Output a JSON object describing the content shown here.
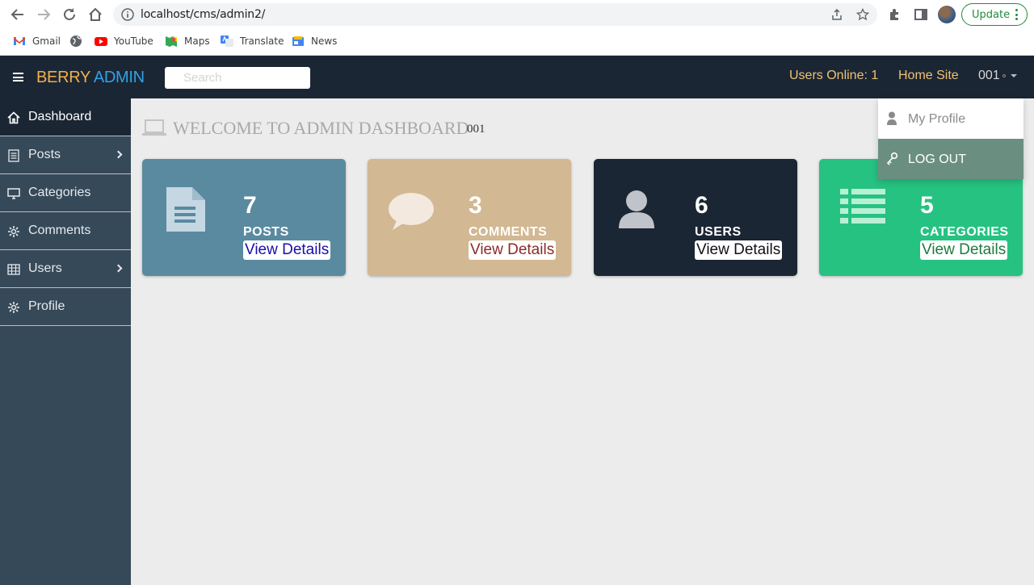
{
  "browser": {
    "url": "localhost/cms/admin2/",
    "update_label": "Update",
    "bookmarks": [
      {
        "label": "Gmail",
        "icon": "gmail-icon"
      },
      {
        "label": "",
        "icon": "globe-icon"
      },
      {
        "label": "YouTube",
        "icon": "youtube-icon"
      },
      {
        "label": "Maps",
        "icon": "maps-icon"
      },
      {
        "label": "Translate",
        "icon": "translate-icon"
      },
      {
        "label": "News",
        "icon": "news-icon"
      }
    ]
  },
  "topnav": {
    "brand_part1": "BERRY",
    "brand_part2": "ADMIN",
    "search_placeholder": "Search",
    "users_online": "Users Online: 1",
    "home_site": "Home Site",
    "username": "001"
  },
  "sidebar": {
    "items": [
      {
        "label": "Dashboard",
        "icon": "home-icon",
        "active": true
      },
      {
        "label": "Posts",
        "icon": "list-icon"
      },
      {
        "label": "Categories",
        "icon": "desktop-icon"
      },
      {
        "label": "Comments",
        "icon": "gear-icon"
      },
      {
        "label": "Users",
        "icon": "table-icon"
      },
      {
        "label": "Profile",
        "icon": "gear-icon"
      }
    ]
  },
  "main": {
    "title": "WELCOME TO ADMIN DASHBOARD",
    "title_user": "001",
    "cards": [
      {
        "count": "7",
        "label": "POSTS",
        "link": "View Details",
        "icon": "file-icon",
        "bg": "#5a8aa0",
        "link_color": "#1a0dab"
      },
      {
        "count": "3",
        "label": "COMMENTS",
        "link": "View Details",
        "icon": "comment-icon",
        "bg": "#d2b893",
        "link_color": "#8b2a2a"
      },
      {
        "count": "6",
        "label": "USERS",
        "link": "View Details",
        "icon": "user-icon",
        "bg": "#1b2634",
        "link_color": "#111111"
      },
      {
        "count": "5",
        "label": "CATEGORIES",
        "link": "View Details",
        "icon": "list-icon",
        "bg": "#26c281",
        "link_color": "#1e7a3e"
      }
    ]
  },
  "dropdown": {
    "my_profile": "My Profile",
    "log_out": "LOG OUT"
  }
}
